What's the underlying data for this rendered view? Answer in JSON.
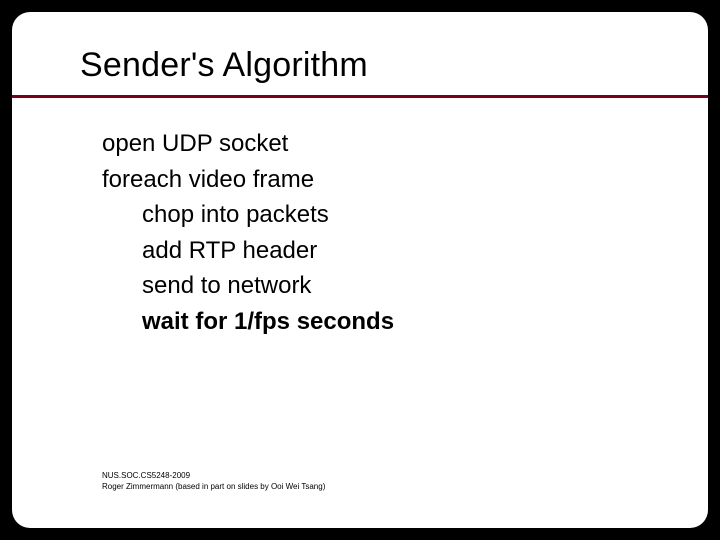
{
  "title": "Sender's Algorithm",
  "lines": {
    "l1": "open UDP socket",
    "l2": "foreach video frame",
    "l3": "chop into packets",
    "l4": "add RTP header",
    "l5": "send to network",
    "l6": "wait for 1/fps seconds"
  },
  "footer": {
    "f1": "NUS.SOC.CS5248-2009",
    "f2": "Roger Zimmermann (based in part on slides by Ooi Wei Tsang)"
  }
}
